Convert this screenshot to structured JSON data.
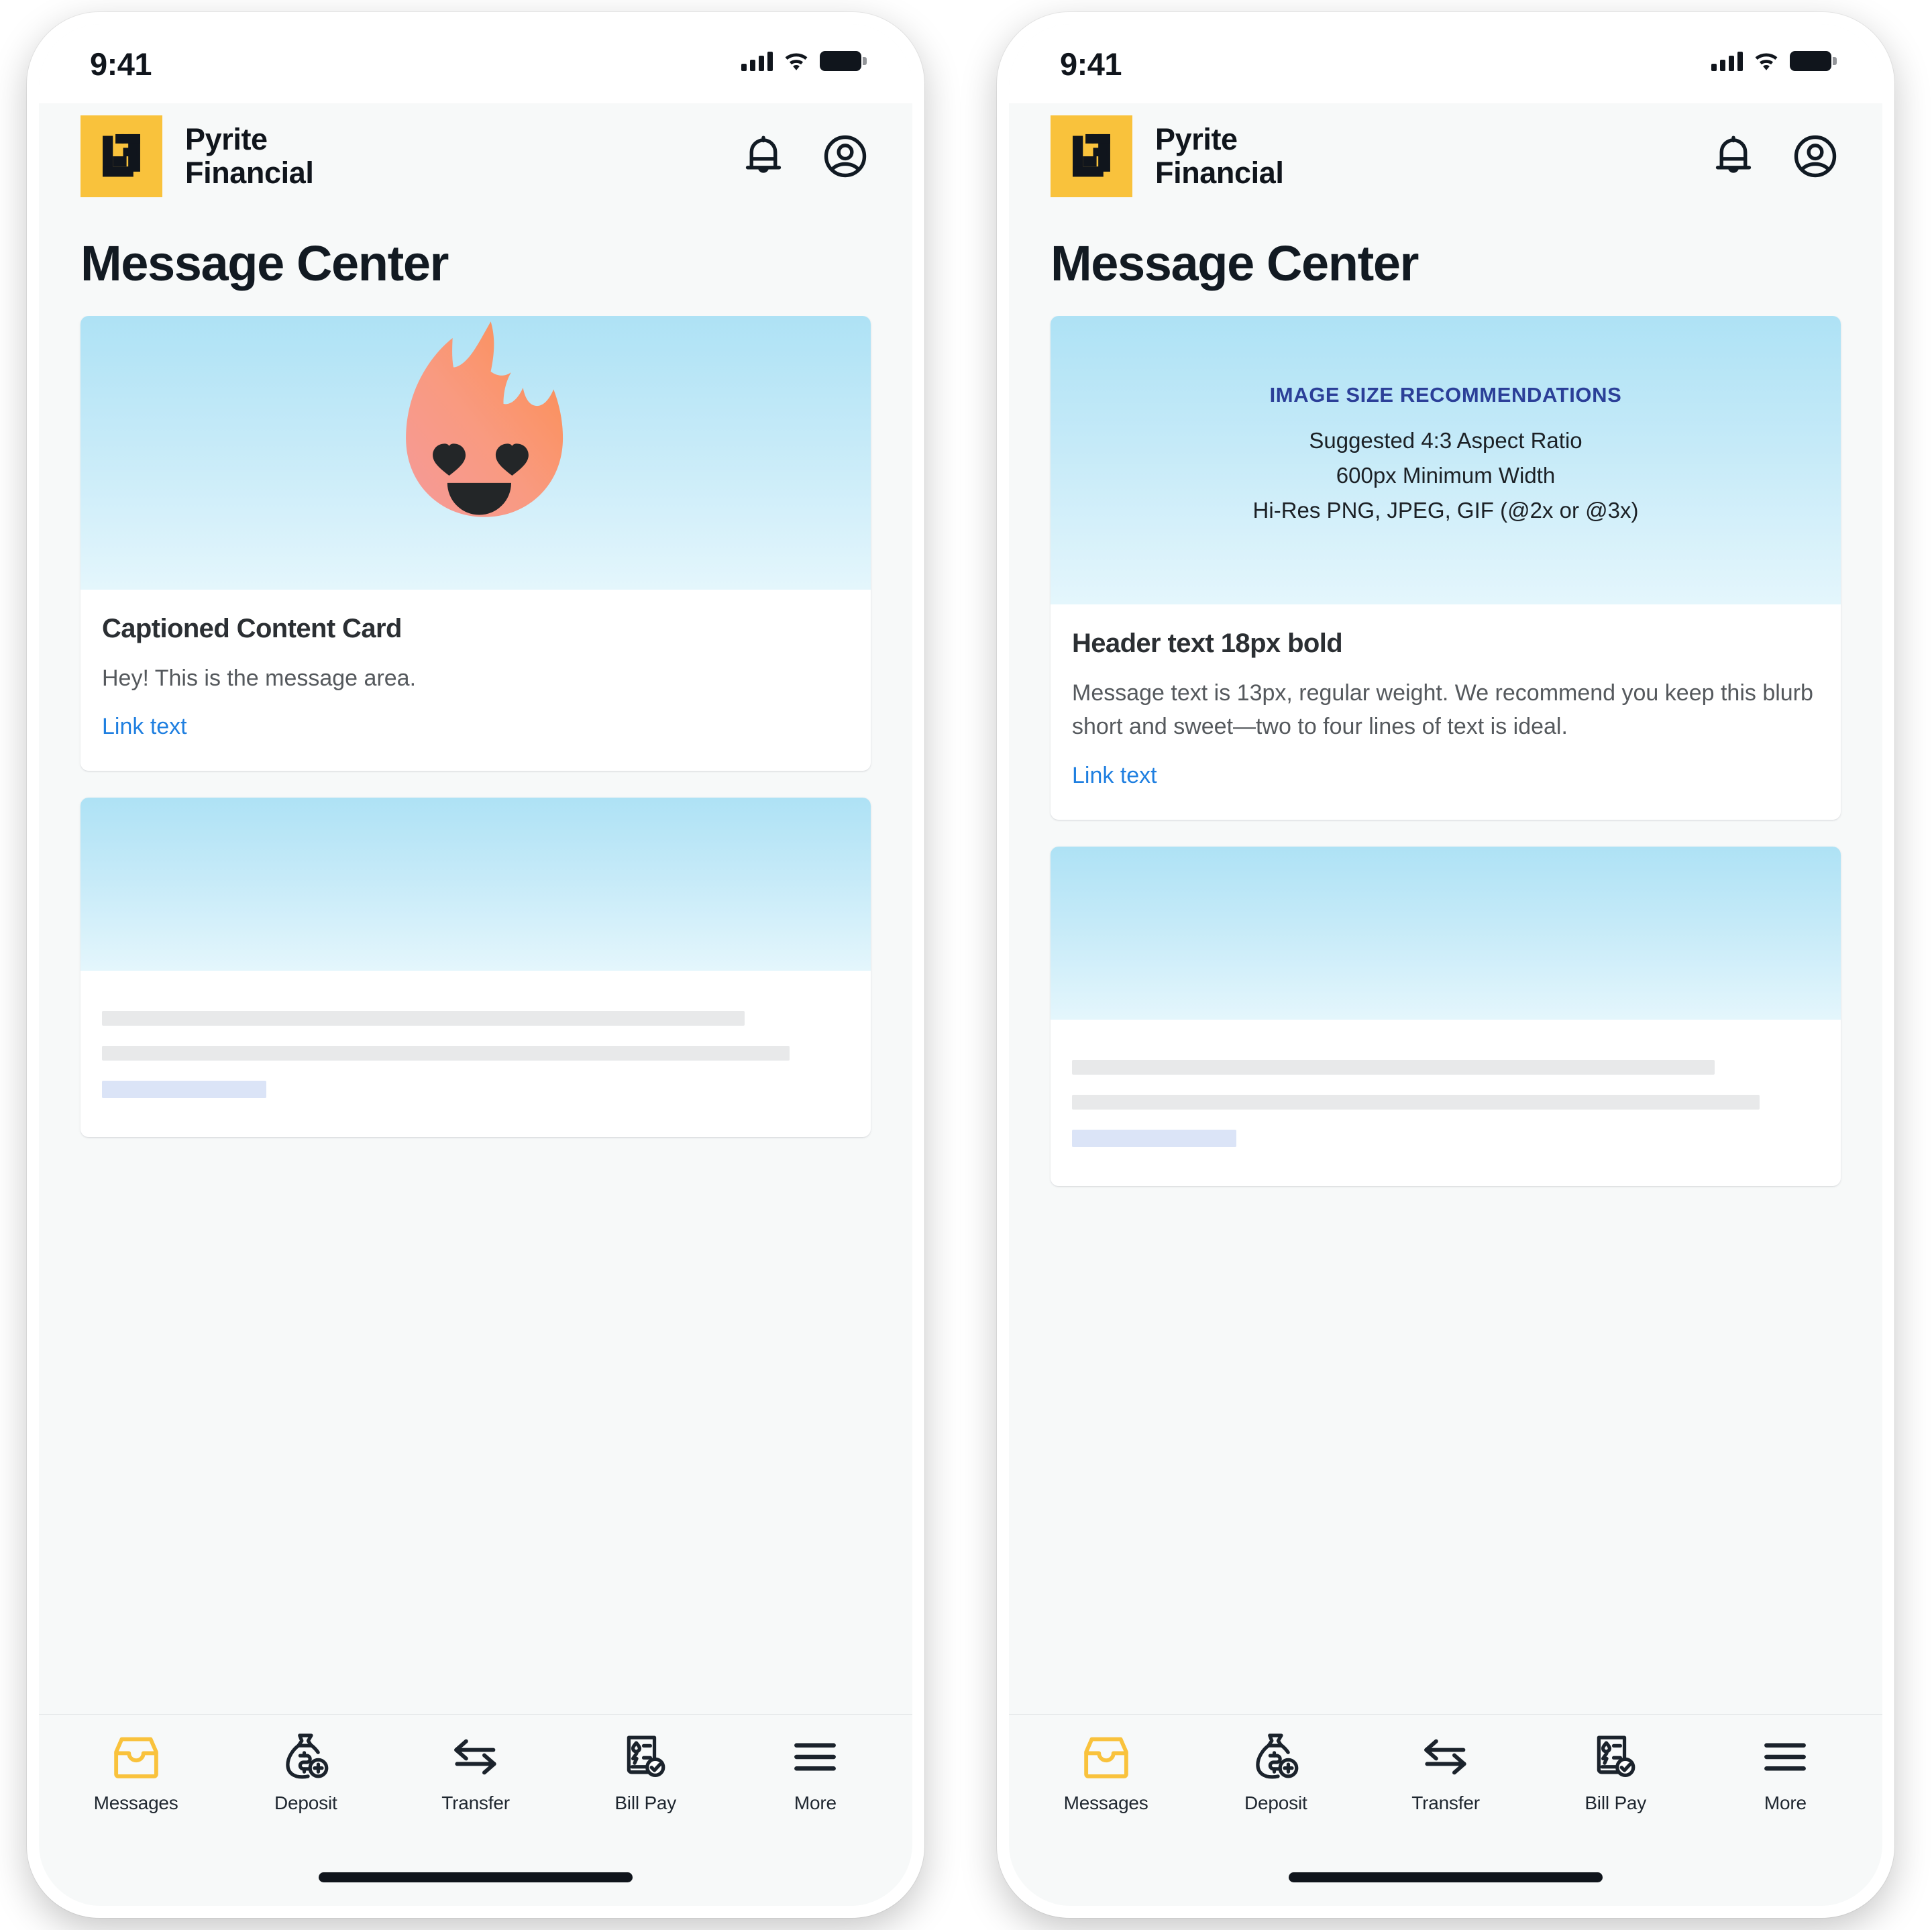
{
  "brand": {
    "name": "Pyrite\nFinancial",
    "logo_color": "#f9c23c",
    "notification_icon": "bell-icon",
    "account_icon": "account-circle-icon"
  },
  "status_bar": {
    "time": "9:41",
    "signal_icon": "cellular-signal-icon",
    "wifi_icon": "wifi-icon",
    "battery_icon": "battery-full-icon"
  },
  "page": {
    "title": "Message Center"
  },
  "left_phone": {
    "hero_card": {
      "media_alt": "flame-heart-eyes-emoji",
      "title": "Captioned Content Card",
      "message": "Hey! This is the message area.",
      "link_label": "Link text"
    },
    "placeholder_card": {
      "line_1": "",
      "line_2": "",
      "link_placeholder": ""
    }
  },
  "right_phone": {
    "hero_card": {
      "recommendation_heading": "IMAGE SIZE RECOMMENDATIONS",
      "recommendation_lines": [
        "Suggested 4:3 Aspect Ratio",
        "600px Minimum Width",
        "Hi-Res PNG, JPEG, GIF (@2x or @3x)"
      ],
      "title": "Header text 18px bold",
      "message": "Message text is 13px, regular weight. We recommend you keep this blurb short and sweet—two to four lines of text is ideal.",
      "link_label": "Link text"
    },
    "placeholder_card": {
      "line_1": "",
      "line_2": "",
      "link_placeholder": ""
    }
  },
  "tab_bar": {
    "items": [
      {
        "label": "Messages",
        "icon": "inbox-tray-icon",
        "active": true
      },
      {
        "label": "Deposit",
        "icon": "money-bag-plus-icon",
        "active": false
      },
      {
        "label": "Transfer",
        "icon": "transfer-arrows-icon",
        "active": false
      },
      {
        "label": "Bill Pay",
        "icon": "bill-check-icon",
        "active": false
      },
      {
        "label": "More",
        "icon": "hamburger-menu-icon",
        "active": false
      }
    ]
  },
  "colors": {
    "accent_yellow": "#f9c23c",
    "link_blue": "#1f7fe0",
    "rec_heading_blue": "#2b3f98",
    "media_blue_top": "#aee2f5",
    "media_blue_bottom": "#e4f6fc",
    "ink": "#10151c",
    "surface": "#f7f9f9"
  }
}
